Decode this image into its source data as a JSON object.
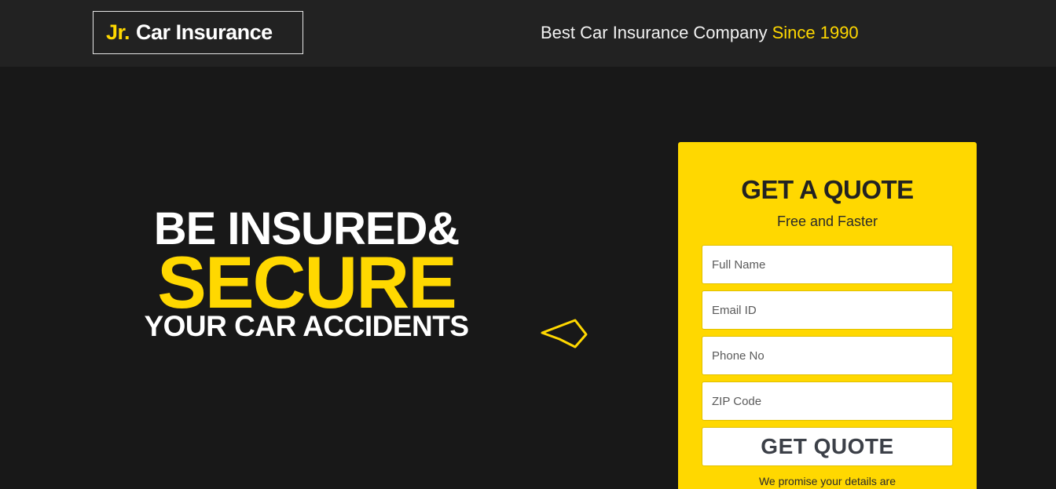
{
  "header": {
    "logo_prefix": "Jr.",
    "logo_name": "Car Insurance",
    "tagline": "Best Car Insurance Company",
    "tagline_highlight": "Since 1990"
  },
  "hero": {
    "line1": "BE INSURED&",
    "line2": "SECURE",
    "line3": "YOUR CAR ACCIDENTS",
    "arrow_icon": "arrow-left-icon"
  },
  "quote_form": {
    "title": "GET A QUOTE",
    "subtitle": "Free and Faster",
    "fields": {
      "full_name_placeholder": "Full Name",
      "email_placeholder": "Email ID",
      "phone_placeholder": "Phone No",
      "zip_placeholder": "ZIP Code"
    },
    "submit_label": "GET QUOTE",
    "promise_text": "We promise your details are"
  },
  "colors": {
    "accent": "#ffd800",
    "background": "#181818",
    "header_background": "#222222"
  }
}
